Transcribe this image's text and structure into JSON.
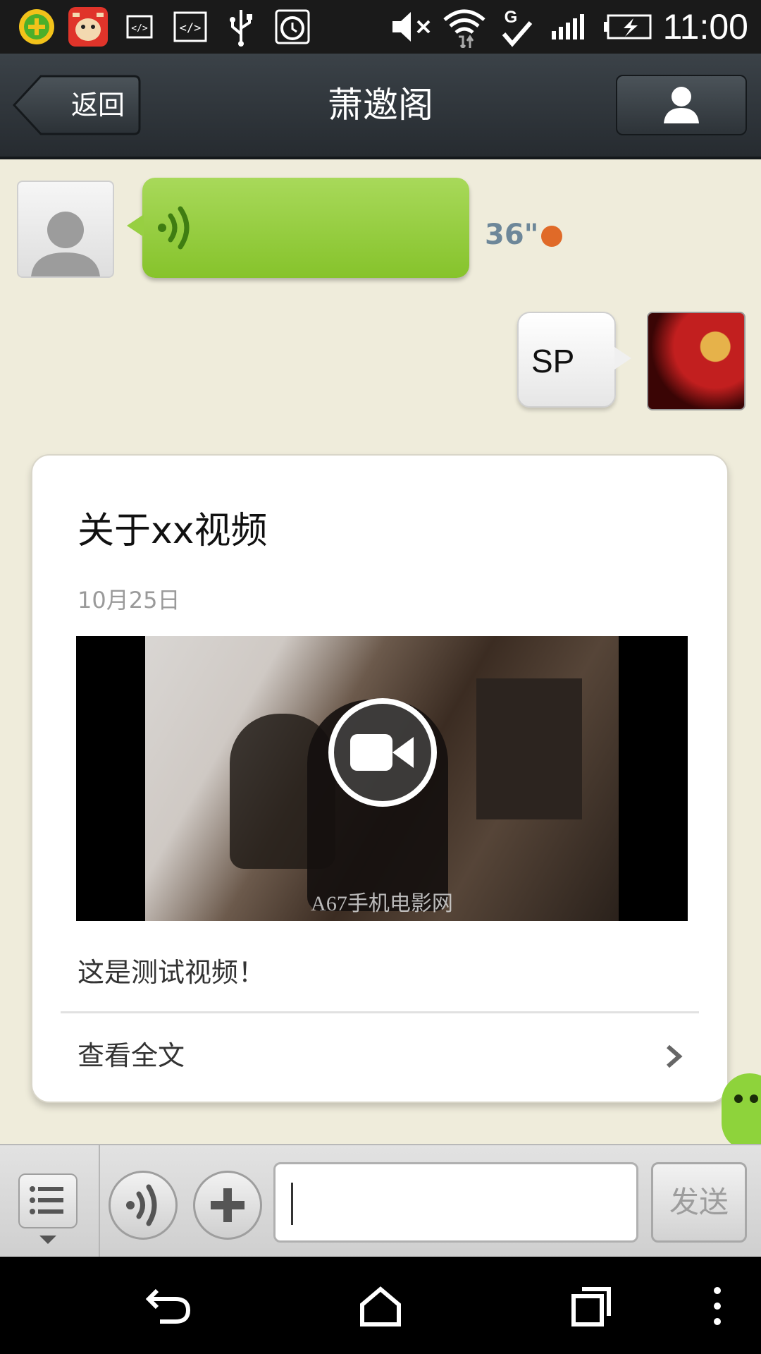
{
  "status_bar": {
    "time": "11:00",
    "icons": [
      "app-360-icon",
      "app-cow-icon",
      "code-icon",
      "code-icon",
      "usb-icon",
      "alarm-icon",
      "mute-icon",
      "wifi-icon",
      "g-signal-icon",
      "cell-signal-icon",
      "battery-charging-icon"
    ]
  },
  "header": {
    "back_label": "返回",
    "title": "萧邀阁",
    "profile_icon": "person-icon"
  },
  "messages": {
    "voice": {
      "duration": "36\"",
      "unread_color": "#e06a28"
    },
    "sent_text": "SP"
  },
  "article": {
    "title": "关于xx视频",
    "date": "10月25日",
    "video_caption": "A67手机电影网",
    "description": "这是测试视频！",
    "read_more": "查看全文"
  },
  "input_bar": {
    "send_label": "发送",
    "text_value": ""
  },
  "nav_bar": {
    "icons": [
      "back-icon",
      "home-icon",
      "recents-icon",
      "overflow-menu-icon"
    ]
  },
  "colors": {
    "voice_bubble": "#8fc935",
    "chat_background": "#efecdb",
    "title_bar": "#2f363b"
  }
}
